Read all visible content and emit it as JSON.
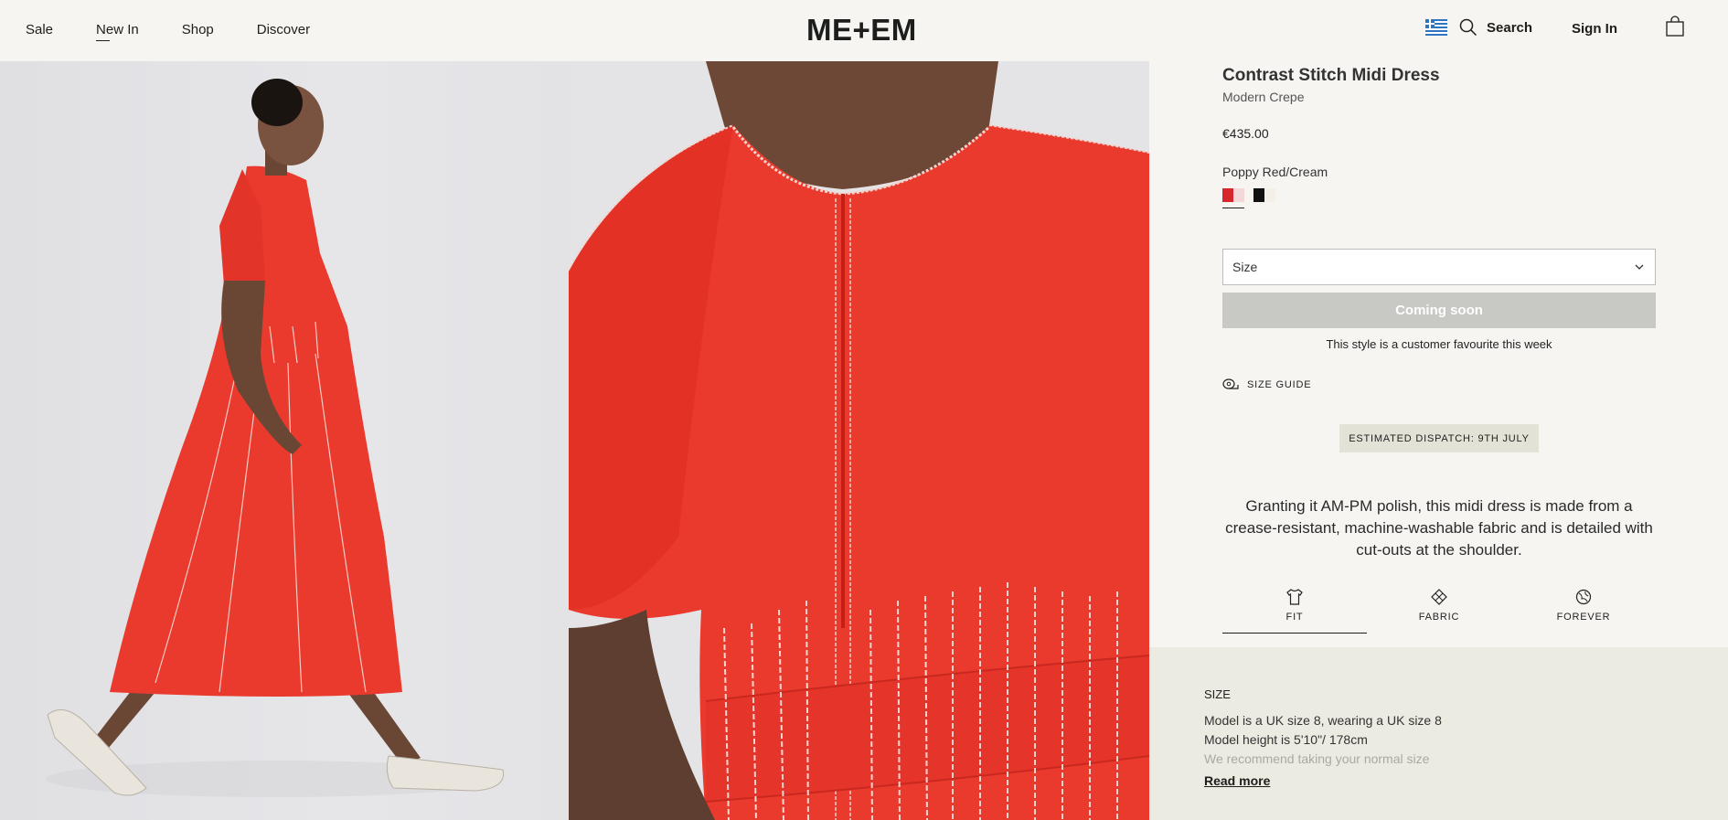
{
  "header": {
    "nav": [
      "Sale",
      "New In",
      "Shop",
      "Discover"
    ],
    "logo": "ME+EM",
    "search_label": "Search",
    "signin_label": "Sign In"
  },
  "product": {
    "title": "Contrast Stitch Midi Dress",
    "subtitle": "Modern Crepe",
    "price": "€435.00",
    "colour": "Poppy Red/Cream",
    "swatches": [
      {
        "name": "Poppy Red/Cream",
        "colors": [
          "#d7262c",
          "#f4d7d8"
        ],
        "selected": true
      },
      {
        "name": "Black/Cream",
        "colors": [
          "#111111",
          "#f4f0e8"
        ],
        "selected": false
      }
    ],
    "size_placeholder": "Size",
    "cta_label": "Coming soon",
    "favourite_text": "This style is a customer favourite this week",
    "size_guide_label": "SIZE GUIDE",
    "dispatch_label": "ESTIMATED DISPATCH: 9TH JULY",
    "description": "Granting it AM-PM polish, this midi dress is made from a crease-resistant, machine-washable fabric and is detailed with cut-outs at the shoulder."
  },
  "tabs": [
    {
      "label": "FIT",
      "icon": "tshirt-icon",
      "active": true
    },
    {
      "label": "FABRIC",
      "icon": "fabric-icon",
      "active": false
    },
    {
      "label": "FOREVER",
      "icon": "globe-icon",
      "active": false
    }
  ],
  "fit": {
    "heading": "SIZE",
    "lines": [
      "Model is a UK size 8, wearing a UK size 8",
      "Model height is 5'10\"/ 178cm",
      "We recommend taking your normal size"
    ],
    "read_more": "Read more"
  },
  "colors": {
    "background": "#f6f5f1",
    "dress_red": "#ea3a2e",
    "button_disabled": "#c8c8c4",
    "fit_panel": "#ecebe2"
  }
}
